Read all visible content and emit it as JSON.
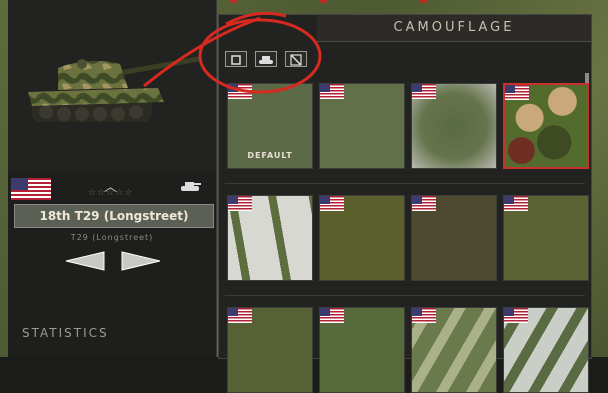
{
  "panel": {
    "title": "CAMOUFLAGE"
  },
  "unit": {
    "name": "18th T29 (Longstreet)",
    "subname": "T29 (Longstreet)",
    "stars": "☆☆☆☆☆",
    "rank_icon": "chevron-icon"
  },
  "sidebar": {
    "statistics_label": "STATISTICS"
  },
  "filters": [
    {
      "icon": "square-icon"
    },
    {
      "icon": "tank-icon"
    },
    {
      "icon": "diagonal-icon"
    }
  ],
  "camos": [
    {
      "label": "DEFAULT",
      "style": "plain-olive",
      "selected": false
    },
    {
      "label": "",
      "style": "plain-olive-light",
      "selected": false
    },
    {
      "label": "",
      "style": "worn-olive",
      "selected": false
    },
    {
      "label": "",
      "style": "woodland",
      "selected": true
    },
    {
      "label": "",
      "style": "winter-tracks",
      "selected": false
    },
    {
      "label": "",
      "style": "olive-dark",
      "selected": false
    },
    {
      "label": "",
      "style": "olive-brown",
      "selected": false
    },
    {
      "label": "",
      "style": "olive-green",
      "selected": false
    },
    {
      "label": "",
      "style": "olive",
      "selected": false
    },
    {
      "label": "",
      "style": "olive-2",
      "selected": false
    },
    {
      "label": "",
      "style": "stripe-green",
      "selected": false
    },
    {
      "label": "",
      "style": "stripe-white",
      "selected": false
    }
  ],
  "colors": {
    "accent": "#c8322c",
    "text": "#c8bfae"
  }
}
